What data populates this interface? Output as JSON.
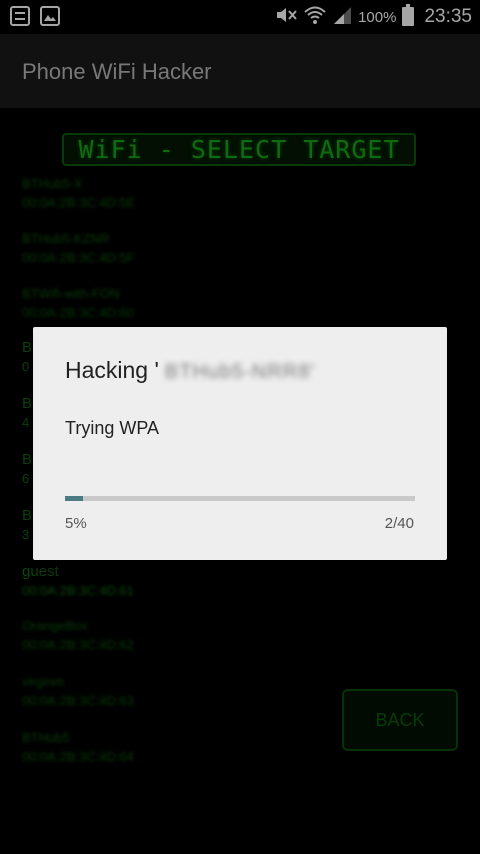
{
  "status_bar": {
    "icons_left": [
      "notification-list-icon",
      "image-icon"
    ],
    "icons_right": [
      "mute-icon",
      "wifi-icon",
      "signal-icon"
    ],
    "battery": "100%",
    "time": "23:35"
  },
  "app_bar": {
    "title": "Phone WiFi Hacker"
  },
  "screen": {
    "header": "WiFi - SELECT TARGET",
    "networks": [
      {
        "name": "BTHub5-X",
        "mac": "00:0A:2B:3C:4D:5E"
      },
      {
        "name": "BTHub5-KZNR",
        "mac": "00:0A:2B:3C:4D:5F"
      },
      {
        "name": "BTWifi-with-FON",
        "mac": "00:0A:2B:3C:4D:60"
      },
      {
        "name": "B",
        "mac": "0"
      },
      {
        "name": "B",
        "mac": "4"
      },
      {
        "name": "B",
        "mac": "6"
      },
      {
        "name": "B",
        "mac": "3"
      },
      {
        "name": "guest",
        "mac": "00:0A:2B:3C:4D:61"
      },
      {
        "name": "OrangeBox",
        "mac": "00:0A:2B:3C:4D:62"
      },
      {
        "name": "virginm",
        "mac": "00:0A:2B:3C:4D:63"
      },
      {
        "name": "BTHub5",
        "mac": "00:0A:2B:3C:4D:64"
      }
    ],
    "back_label": "BACK"
  },
  "dialog": {
    "title_prefix": "Hacking '",
    "target_ssid": "BTHub5-NRR8'",
    "message": "Trying WPA",
    "progress": 0.05,
    "percent_label": "5%",
    "count_label": "2/40"
  },
  "colors": {
    "terminal_green": "#19a319",
    "progress_fill": "#4a7c82",
    "dialog_bg": "#eeeeee"
  }
}
